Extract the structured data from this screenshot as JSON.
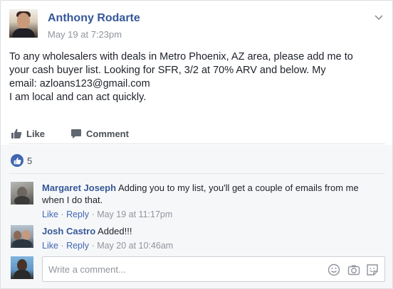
{
  "post": {
    "author": "Anthony Rodarte",
    "timestamp": "May 19 at 7:23pm",
    "text_lines": [
      "To any wholesalers with deals in Metro Phoenix, AZ area, please add me to",
      "your cash buyer list. Looking for SFR, 3/2 at 70% ARV and below. My",
      "email: azloans123@gmail.com",
      "I am local and can act quickly."
    ],
    "options_icon": "chevron-down-icon"
  },
  "actions": {
    "like_label": "Like",
    "comment_label": "Comment",
    "like_icon": "thumbs-up-icon",
    "comment_icon": "speech-bubble-icon"
  },
  "reactions": {
    "count": "5",
    "icon": "like-reaction-icon",
    "color": "#4267b2"
  },
  "comments": [
    {
      "author": "Margaret Joseph",
      "text_line1": "Adding you to my list, you'll get a couple of emails from me",
      "text_line2": "when I do that.",
      "like_label": "Like",
      "reply_label": "Reply",
      "separator": "·",
      "time": "May 19 at 11:17pm"
    },
    {
      "author": "Josh Castro",
      "text_line1": "Added!!!",
      "like_label": "Like",
      "reply_label": "Reply",
      "separator": "·",
      "time": "May 20 at 10:46am"
    }
  ],
  "write_comment": {
    "placeholder": "Write a comment...",
    "icons": [
      "emoji-icon",
      "camera-icon",
      "sticker-icon"
    ]
  },
  "colors": {
    "link_blue": "#365899",
    "accent_blue": "#4267b2",
    "meta_gray": "#90949c",
    "text": "#1d2129"
  }
}
